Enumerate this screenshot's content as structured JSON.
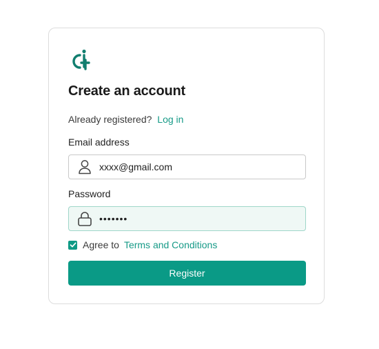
{
  "form": {
    "title": "Create an account",
    "login_prompt": "Already registered?",
    "login_link": "Log in",
    "email_label": "Email address",
    "email_value": "xxxx@gmail.com",
    "password_label": "Password",
    "password_value": "•••••••",
    "agree_text": "Agree to",
    "terms_link": "Terms and Conditions",
    "agree_checked": true,
    "register_label": "Register"
  },
  "icons": {
    "logo": "app-logo-icon",
    "email": "user-icon",
    "password": "lock-icon",
    "checkbox": "checkmark-icon"
  },
  "colors": {
    "accent": "#0a9a86",
    "link": "#169a87",
    "password_field_bg": "#eff8f5",
    "password_field_border": "#9ed6c9",
    "card_border": "#dcdcdc"
  }
}
